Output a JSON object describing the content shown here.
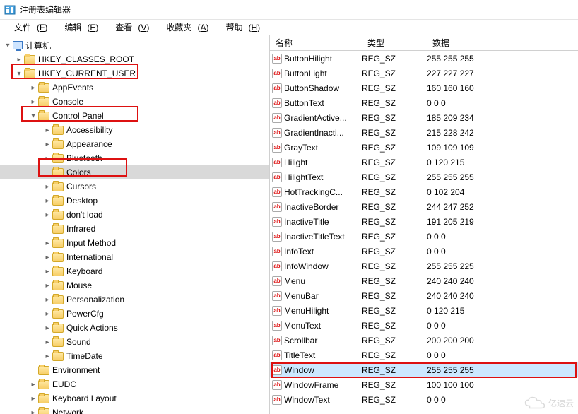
{
  "window": {
    "title": "注册表编辑器"
  },
  "menu": {
    "file": {
      "label": "文件",
      "key": "F"
    },
    "edit": {
      "label": "编辑",
      "key": "E"
    },
    "view": {
      "label": "查看",
      "key": "V"
    },
    "fav": {
      "label": "收藏夹",
      "key": "A"
    },
    "help": {
      "label": "帮助",
      "key": "H"
    }
  },
  "tree": {
    "root": "计算机",
    "hkcr": "HKEY_CLASSES_ROOT",
    "hkcu": "HKEY_CURRENT_USER",
    "hkcu_children": {
      "appevents": "AppEvents",
      "console": "Console",
      "cp": "Control Panel",
      "cp_children": [
        "Accessibility",
        "Appearance",
        "Bluetooth",
        "Colors",
        "Cursors",
        "Desktop",
        "don't load",
        "Infrared",
        "Input Method",
        "International",
        "Keyboard",
        "Mouse",
        "Personalization",
        "PowerCfg",
        "Quick Actions",
        "Sound",
        "TimeDate"
      ],
      "environment": "Environment",
      "eudc": "EUDC",
      "kbd": "Keyboard Layout",
      "network": "Network"
    }
  },
  "columns": {
    "name": "名称",
    "type": "类型",
    "data": "数据"
  },
  "values": [
    {
      "name": "ButtonHilight",
      "type": "REG_SZ",
      "data": "255 255 255"
    },
    {
      "name": "ButtonLight",
      "type": "REG_SZ",
      "data": "227 227 227"
    },
    {
      "name": "ButtonShadow",
      "type": "REG_SZ",
      "data": "160 160 160"
    },
    {
      "name": "ButtonText",
      "type": "REG_SZ",
      "data": "0 0 0"
    },
    {
      "name": "GradientActive...",
      "type": "REG_SZ",
      "data": "185 209 234"
    },
    {
      "name": "GradientInacti...",
      "type": "REG_SZ",
      "data": "215 228 242"
    },
    {
      "name": "GrayText",
      "type": "REG_SZ",
      "data": "109 109 109"
    },
    {
      "name": "Hilight",
      "type": "REG_SZ",
      "data": "0 120 215"
    },
    {
      "name": "HilightText",
      "type": "REG_SZ",
      "data": "255 255 255"
    },
    {
      "name": "HotTrackingC...",
      "type": "REG_SZ",
      "data": "0 102 204"
    },
    {
      "name": "InactiveBorder",
      "type": "REG_SZ",
      "data": "244 247 252"
    },
    {
      "name": "InactiveTitle",
      "type": "REG_SZ",
      "data": "191 205 219"
    },
    {
      "name": "InactiveTitleText",
      "type": "REG_SZ",
      "data": "0 0 0"
    },
    {
      "name": "InfoText",
      "type": "REG_SZ",
      "data": "0 0 0"
    },
    {
      "name": "InfoWindow",
      "type": "REG_SZ",
      "data": "255 255 225"
    },
    {
      "name": "Menu",
      "type": "REG_SZ",
      "data": "240 240 240"
    },
    {
      "name": "MenuBar",
      "type": "REG_SZ",
      "data": "240 240 240"
    },
    {
      "name": "MenuHilight",
      "type": "REG_SZ",
      "data": "0 120 215"
    },
    {
      "name": "MenuText",
      "type": "REG_SZ",
      "data": "0 0 0"
    },
    {
      "name": "Scrollbar",
      "type": "REG_SZ",
      "data": "200 200 200"
    },
    {
      "name": "TitleText",
      "type": "REG_SZ",
      "data": "0 0 0"
    },
    {
      "name": "Window",
      "type": "REG_SZ",
      "data": "255 255 255",
      "selected": true
    },
    {
      "name": "WindowFrame",
      "type": "REG_SZ",
      "data": "100 100 100"
    },
    {
      "name": "WindowText",
      "type": "REG_SZ",
      "data": "0 0 0"
    }
  ],
  "watermark": "亿速云"
}
